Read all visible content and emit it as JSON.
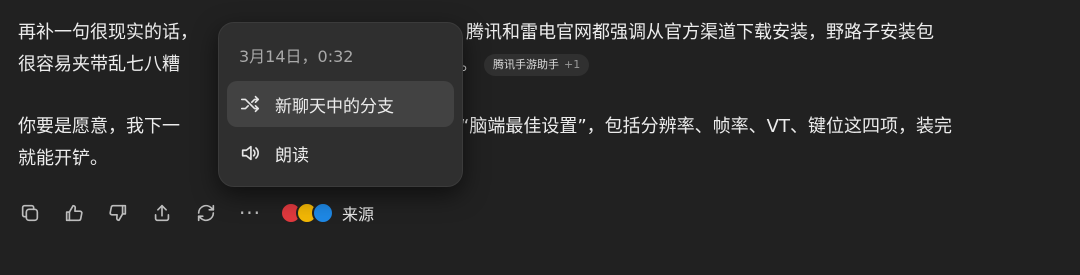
{
  "message": {
    "para1": {
      "line1_before": "再补一句很现实的话，",
      "line1_after": "下。腾讯和雷电官网都强调从官方渠道下载安装，野路子安装包",
      "line2_before": "很容易夹带乱七八糟",
      "line2_after": "。"
    },
    "para2": {
      "line1_before": "你要是愿意，我下一",
      "line1_after": "“脑端最佳设置”，包括分辨率、帧率、VT、键位这四项，装完",
      "line2": "就能开铲。"
    },
    "citation": {
      "label": "腾讯手游助手",
      "more": "+1"
    }
  },
  "actions": {
    "icons": [
      "copy-icon",
      "thumbs-up-icon",
      "thumbs-down-icon",
      "share-icon",
      "regenerate-icon",
      "more-icon"
    ],
    "more": "···",
    "sources_label": "来源",
    "source_colors": [
      "#e0393e",
      "#f2b705",
      "#1e88e5"
    ]
  },
  "context_menu": {
    "date": "3月14日，0:32",
    "items": [
      {
        "label": "新聊天中的分支",
        "icon": "branch-icon"
      },
      {
        "label": "朗读",
        "icon": "speaker-icon"
      }
    ]
  }
}
